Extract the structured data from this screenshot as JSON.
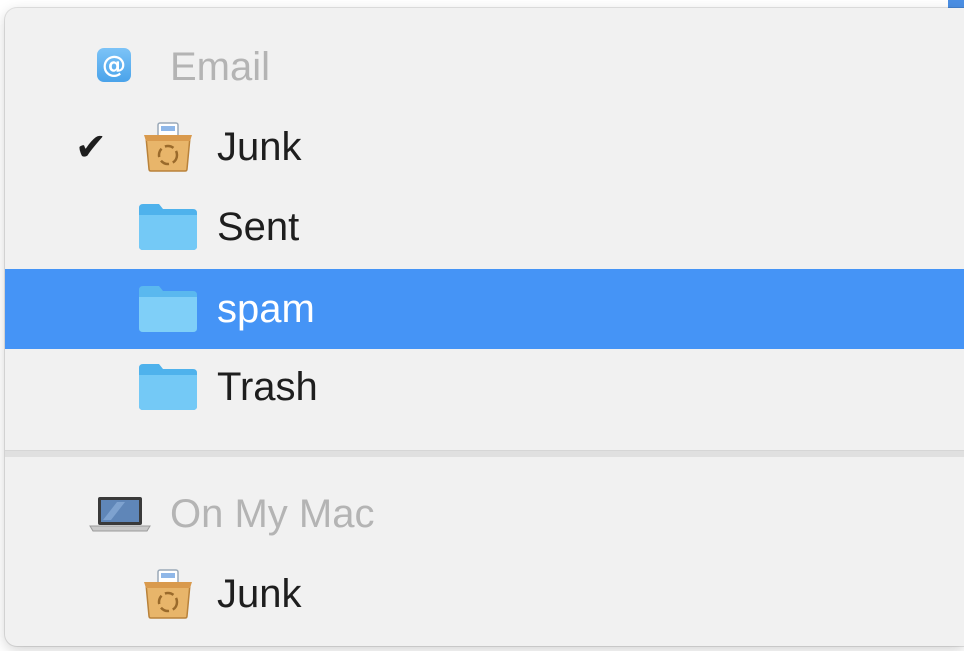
{
  "menu": {
    "sections": [
      {
        "header": {
          "label": "Email",
          "icon": "at-sign-icon"
        },
        "items": [
          {
            "label": "Junk",
            "icon": "junk-mailbox-icon",
            "checked": true,
            "selected": false
          },
          {
            "label": "Sent",
            "icon": "folder-icon",
            "checked": false,
            "selected": false
          },
          {
            "label": "spam",
            "icon": "folder-icon",
            "checked": false,
            "selected": true
          },
          {
            "label": "Trash",
            "icon": "folder-icon",
            "checked": false,
            "selected": false
          }
        ]
      },
      {
        "header": {
          "label": "On My Mac",
          "icon": "macbook-icon"
        },
        "items": [
          {
            "label": "Junk",
            "icon": "junk-mailbox-icon",
            "checked": false,
            "selected": false
          }
        ]
      }
    ],
    "check_glyph": "✔",
    "colors": {
      "selection": "#4594f6",
      "header_text": "#b4b4b4",
      "item_text": "#1e1e1e",
      "folder": "#6cc5f4"
    }
  }
}
